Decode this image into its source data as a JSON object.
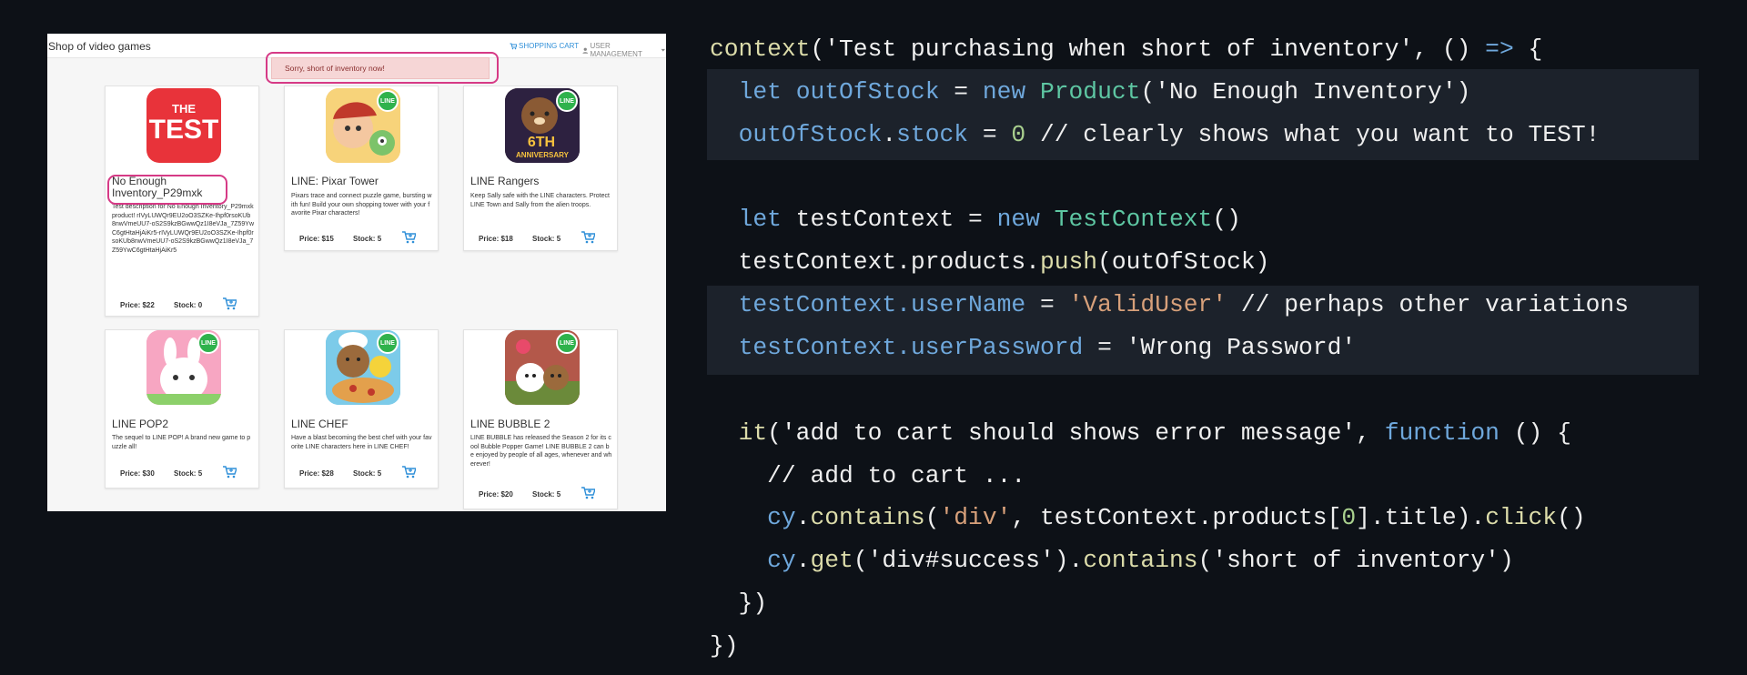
{
  "shop": {
    "brand": "Shop of video games",
    "nav_cart": "SHOPPING CART",
    "nav_user": "USER MANAGEMENT",
    "alert": "Sorry, short of inventory now!",
    "price_label": "Price:",
    "stock_label": "Stock:",
    "products": [
      {
        "title": "No Enough Inventory_P29mxk",
        "description": "Test description for No Enough Inventory_P29mxk product! rIVyLUWQr9EU2oO3SZKe-Ihpf0rsoKUb8nwVmeUU7-oS2S9kzBGwwQz1I8eVJa_7Z59YwC6gtHtaHjAiKr5-rIVyLUWQr9EU2oO3SZKe-Ihpf0rsoKUb8nwVmeUU7-oS2S9kzBGwwQz1I8eVJa_7Z59YwC6gtHtaHjAiKr5",
        "price": "$22",
        "stock": "0",
        "icon_text": "THE TEST"
      },
      {
        "title": "LINE: Pixar Tower",
        "description": "Pixars trace and connect puzzle game, bursting with fun! Build your own shopping tower with your favorite Pixar characters!",
        "price": "$15",
        "stock": "5",
        "badge": "LINE"
      },
      {
        "title": "LINE Rangers",
        "description": "Keep Sally safe with the LINE characters. Protect LINE Town and Sally from the alien troops.",
        "price": "$18",
        "stock": "5",
        "badge": "LINE",
        "icon_text_top": "6TH",
        "icon_text_bottom": "ANNIVERSARY"
      },
      {
        "title": "LINE POP2",
        "description": "The sequel to LINE POP! A brand new game to puzzle all!",
        "price": "$30",
        "stock": "5",
        "badge": "LINE"
      },
      {
        "title": "LINE CHEF",
        "description": "Have a blast becoming the best chef with your favorite LINE characters here in LINE CHEF!",
        "price": "$28",
        "stock": "5",
        "badge": "LINE"
      },
      {
        "title": "LINE BUBBLE 2",
        "description": "LINE BUBBLE has released the Season 2 for its cool Bubble Popper Game! LINE BUBBLE 2 can be enjoyed by people of all ages, whenever and wherever!",
        "price": "$20",
        "stock": "5",
        "badge": "LINE"
      }
    ]
  },
  "code": {
    "l1": [
      "context",
      "(",
      "'Test purchasing when short of inventory'",
      ", () ",
      "=>",
      " {"
    ],
    "l2": [
      "  ",
      "let",
      " ",
      "outOfStock",
      " = ",
      "new",
      " ",
      "Product",
      "(",
      "'No Enough Inventory'",
      ")"
    ],
    "l3": [
      "  ",
      "outOfStock",
      ".",
      "stock",
      " = ",
      "0",
      " // clearly shows what you want to TEST!"
    ],
    "l5": [
      "  ",
      "let",
      " testContext = ",
      "new",
      " ",
      "TestContext",
      "()"
    ],
    "l6": [
      "  testContext.products.",
      "push",
      "(outOfStock)"
    ],
    "l7": [
      "  ",
      "testContext",
      ".",
      "userName",
      " = ",
      "'ValidUser'",
      " // perhaps other variations"
    ],
    "l8": [
      "  ",
      "testContext",
      ".",
      "userPassword",
      " = ",
      "'Wrong Password'"
    ],
    "l10": [
      "  ",
      "it",
      "(",
      "'add to cart should shows error message'",
      ", ",
      "function",
      " () {"
    ],
    "l11": [
      "    // add to cart ..."
    ],
    "l12": [
      "    ",
      "cy",
      ".",
      "contains",
      "(",
      "'div'",
      ", testContext.products[",
      "0",
      "].title).",
      "click",
      "()"
    ],
    "l13": [
      "    ",
      "cy",
      ".",
      "get",
      "(",
      "'div#success'",
      ").",
      "contains",
      "(",
      "'short of inventory'",
      ")"
    ],
    "l14": [
      "  })"
    ],
    "l15": [
      "})"
    ]
  },
  "colors": {
    "background": "#0d1117",
    "highlight": "#1c222b",
    "keyword": "#6fa8dc",
    "class": "#5ec7a3",
    "function": "#dcdcaa",
    "accent_ring": "#d63a86",
    "link": "#2f8fd8"
  }
}
